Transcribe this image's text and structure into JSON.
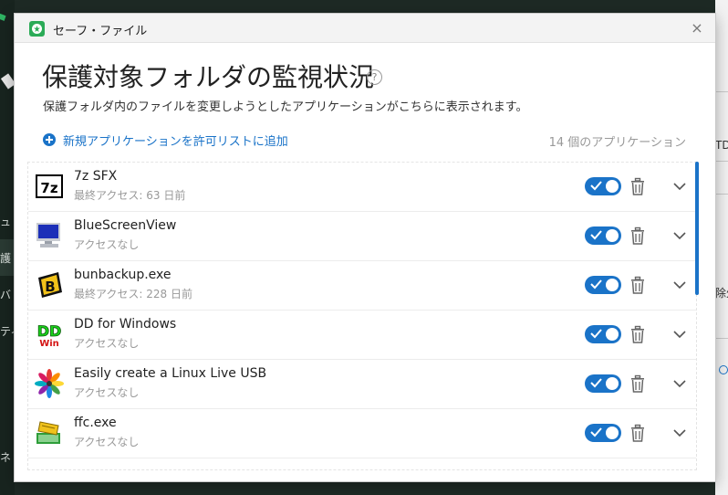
{
  "background": {
    "left_texts": [
      "ュ",
      "護",
      "バ",
      "ティ",
      "ネ"
    ],
    "right_texts": [
      "TD",
      "除外",
      "?"
    ]
  },
  "window": {
    "title": "セーフ・ファイル",
    "close": "×"
  },
  "page": {
    "title": "保護対象フォルダの監視状況",
    "help": "?",
    "subtitle": "保護フォルダ内のファイルを変更しようとしたアプリケーションがこちらに表示されます。",
    "add_label": "新規アプリケーションを許可リストに追加",
    "count": "14 個のアプリケーション"
  },
  "apps": [
    {
      "name": "7z SFX",
      "sub": "最終アクセス: 63 日前",
      "icon": "7z-icon",
      "enabled": true
    },
    {
      "name": "BlueScreenView",
      "sub": "アクセスなし",
      "icon": "monitor-icon",
      "enabled": true
    },
    {
      "name": "bunbackup.exe",
      "sub": "最終アクセス: 228 日前",
      "icon": "bunbackup-icon",
      "enabled": true
    },
    {
      "name": "DD for Windows",
      "sub": "アクセスなし",
      "icon": "dd-icon",
      "enabled": true
    },
    {
      "name": "Easily create a Linux Live USB",
      "sub": "アクセスなし",
      "icon": "flower-icon",
      "enabled": true
    },
    {
      "name": "ffc.exe",
      "sub": "アクセスなし",
      "icon": "ffc-icon",
      "enabled": true
    }
  ],
  "colors": {
    "accent": "#1a73c8",
    "brand_green": "#2bab57"
  }
}
